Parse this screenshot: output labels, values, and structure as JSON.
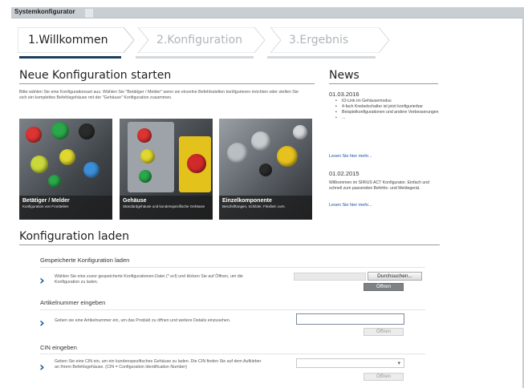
{
  "window": {
    "title": "Systemkonfigurator"
  },
  "steps": [
    {
      "label": "1.Willkommen",
      "active": true
    },
    {
      "label": "2.Konfiguration",
      "active": false
    },
    {
      "label": "3.Ergebnis",
      "active": false
    }
  ],
  "new_config": {
    "heading": "Neue Konfiguration starten",
    "intro": "Bitte wählen Sie eine Konfigurationsart aus. Wählen Sie \"Betätiger / Melder\" wenn sie einzelne Befehlsstellen konfigurieren möchten oder stellen Sie sich ein komplettes Befehlsgehäuse mit der \"Gehäuse\" Konfiguration zusammen.",
    "tiles": [
      {
        "title": "Betätiger / Melder",
        "subtitle": "Konfiguration von Frontteilen"
      },
      {
        "title": "Gehäuse",
        "subtitle": "Standardgehäuse und kundenspezifische Gehäuse"
      },
      {
        "title": "Einzelkomponente",
        "subtitle": "Beschriftungen, Schilder, Flexibel, uvm."
      }
    ]
  },
  "news": {
    "heading": "News",
    "items": [
      {
        "date": "01.03.2016",
        "bullets": [
          "IO-Link im Gehäusemodus",
          "4-fach Knebelschalter ist jetzt konfigurierbar",
          "Beispielkonfigurationen und andere Verbesserungen",
          "..."
        ],
        "link": "Lesen Sie hier mehr..."
      },
      {
        "date": "01.02.2015",
        "text": "Willkommen im SIRIUS ACT Konfigurator. Einfach und schnell zum passenden Befehls- und Meldegerät.",
        "link": "Lesen Sie hier mehr..."
      }
    ]
  },
  "load_config": {
    "heading": "Konfiguration laden",
    "sections": [
      {
        "title": "Gespeicherte Konfiguration laden",
        "text": "Wählen Sie eine zuvor gespeicherte Konfigurationen-Datei (*.scf) und klicken Sie auf Öffnen, um die Konfiguration zu laden.",
        "browse_label": "Durchsuchen...",
        "open_label": "Öffnen"
      },
      {
        "title": "Artikelnummer eingeben",
        "text": "Geben sie eine Artikelnummer ein, um das Produkt zu öffnen und weitere Details einzusehen.",
        "input_value": "",
        "open_label": "Öffnen"
      },
      {
        "title": "CIN eingeben",
        "text": "Geben Sie eine CIN ein, um ein kundenspezifisches Gehäuse zu laden. Die CIN finden Sie auf dem Aufkleber an Ihrem Befehlsgehäuse. (CIN = Configuration Identification Number)",
        "select_value": "",
        "open_label": "Öffnen"
      }
    ]
  },
  "colors": {
    "accent": "#1d3f5f",
    "link": "#1a4f9a",
    "chevron": "#1d5a99"
  }
}
